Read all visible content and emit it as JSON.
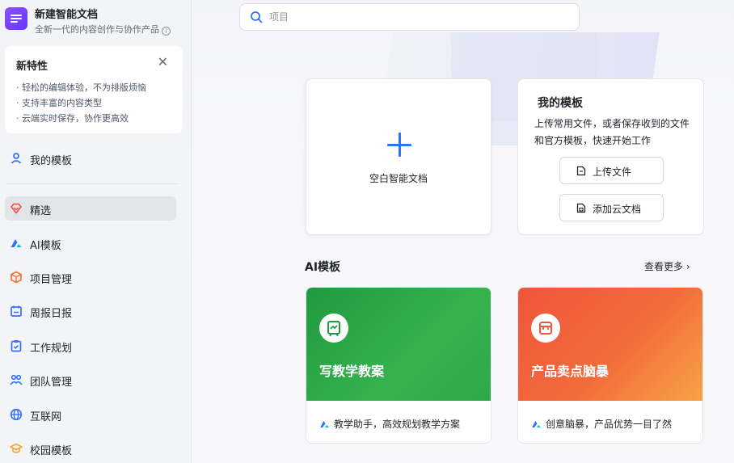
{
  "app": {
    "title": "新建智能文档",
    "subtitle": "全新一代的内容创作与协作产品",
    "info_icon": "info-icon"
  },
  "search": {
    "placeholder": "项目"
  },
  "features": {
    "title": "新特性",
    "items": [
      "· 轻松的编辑体验，不为排版烦恼",
      "· 支持丰富的内容类型",
      "· 云端实时保存，协作更高效"
    ]
  },
  "sidebar": {
    "items": [
      {
        "label": "我的模板",
        "icon": "user-icon",
        "color": "#3370ff"
      },
      {
        "label": "精选",
        "icon": "featured-icon",
        "color": "#f54a45"
      },
      {
        "label": "AI模板",
        "icon": "ai-icon",
        "color": "#3370ff"
      },
      {
        "label": "项目管理",
        "icon": "cube-icon",
        "color": "#f77234"
      },
      {
        "label": "周报日报",
        "icon": "calendar-icon",
        "color": "#3370ff"
      },
      {
        "label": "工作规划",
        "icon": "clipboard-icon",
        "color": "#3370ff"
      },
      {
        "label": "团队管理",
        "icon": "team-icon",
        "color": "#3370ff"
      },
      {
        "label": "互联网",
        "icon": "globe-icon",
        "color": "#3370ff"
      },
      {
        "label": "校园模板",
        "icon": "graduation-cap-icon",
        "color": "#f5a623"
      }
    ]
  },
  "blank": {
    "label": "空白智能文档"
  },
  "my_templates": {
    "title": "我的模板",
    "desc": "上传常用文件，或者保存收到的文件和官方模板，快速开始工作",
    "upload_label": "上传文件",
    "add_cloud_label": "添加云文档"
  },
  "ai_section": {
    "title": "AI模板",
    "see_more": "查看更多 ›",
    "cards": [
      {
        "name": "写教学教案",
        "desc": "教学助手，高效规划教学方案",
        "color": "#2aa345"
      },
      {
        "name": "产品卖点脑暴",
        "desc": "创意脑暴，产品优势一目了然",
        "color": "#f0553a"
      }
    ]
  },
  "colors": {
    "accent": "#3370ff",
    "brand_purple": "#7b48ff"
  }
}
